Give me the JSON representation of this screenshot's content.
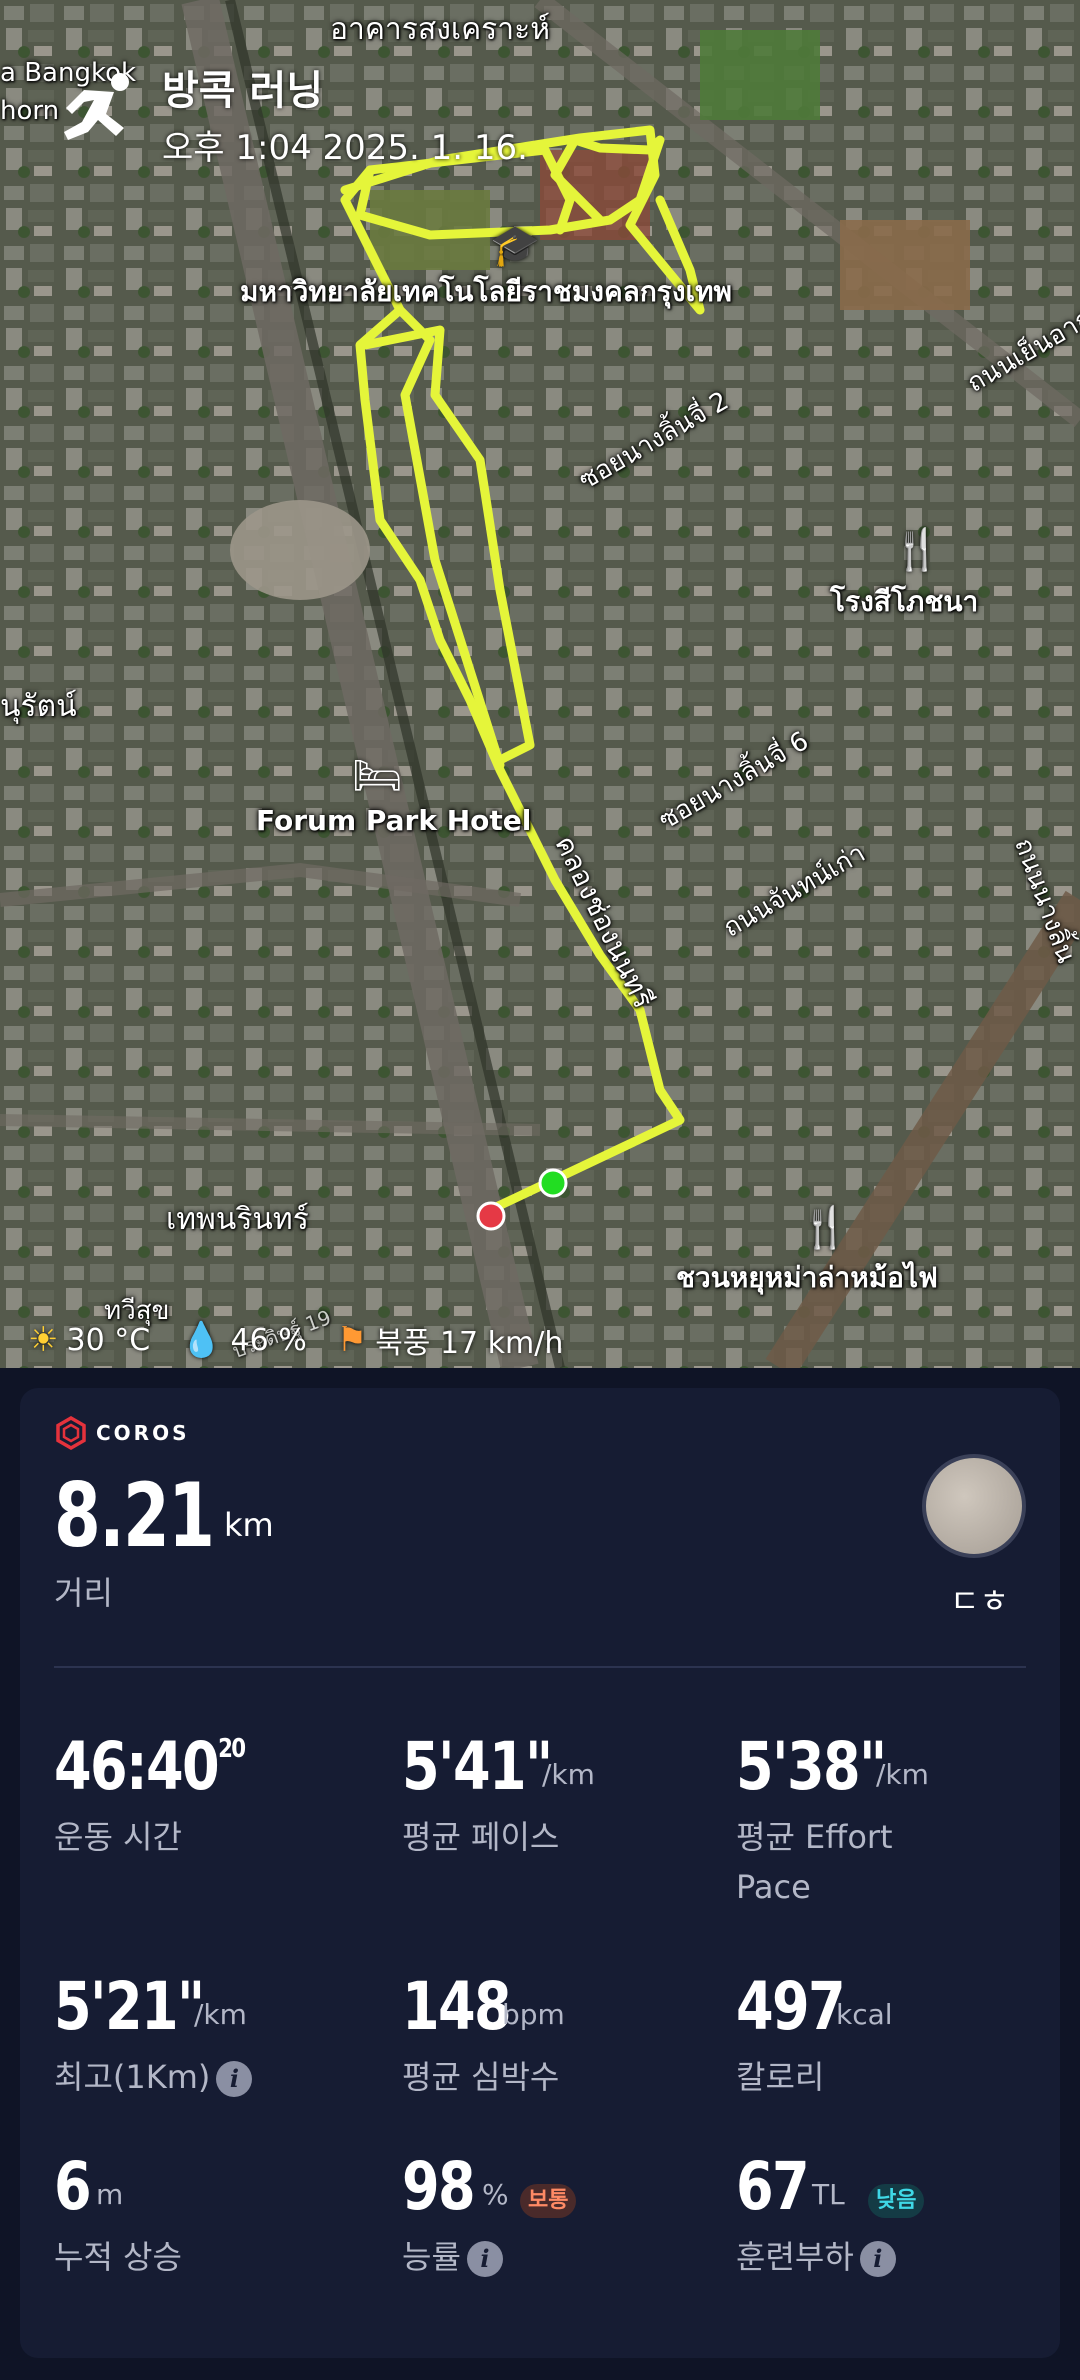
{
  "header": {
    "title": "방콕 러닝",
    "date": "오후 1:04 2025. 1. 16."
  },
  "map": {
    "labels": {
      "top_building": "อาคารสงเคราะห์",
      "corner_left_1": "a Bangkok",
      "corner_left_2": "horn",
      "university": "มหาวิทยาลัยเทคโนโลยีราชมงคลกรุงเทพ",
      "soi_2": "ซอยนางลิ้นจี่ 2",
      "road_right_top": "ถนนเย็นอาก",
      "restaurant_1": "โรงสีโภชนา",
      "left_mid": "นุรัตน์",
      "soi_6": "ซอยนางลิ้นจี่ 6",
      "hotel": "Forum Park Hotel",
      "canal": "คลองช่องนนทรี",
      "road_mid": "ถนนจันทน์เก่า",
      "road_right_mid": "ถนนนางลิ้น",
      "bottom_left": "เทพนรินทร์",
      "restaurant_2": "ชวนหยุหม่าล่าหม้อไฟ",
      "bottom_tiny": "ทวีสุข",
      "bottom_tiny_2": "ประดิษฐ์ 19"
    }
  },
  "weather": {
    "temp": "30 °C",
    "humidity": "46 %",
    "wind": "북풍 17 km/h"
  },
  "card": {
    "brand": "COROS",
    "distance": {
      "value": "8.21",
      "unit": "km",
      "label": "거리"
    },
    "user_name": "ㄷㅎ",
    "stats": {
      "duration": {
        "value": "46:40",
        "sup": "20",
        "label": "운동 시간"
      },
      "avg_pace": {
        "value": "5'41\"",
        "unit": "/km",
        "label": "평균 페이스"
      },
      "effort_pace": {
        "value": "5'38\"",
        "unit": "/km",
        "label": "평균 Effort Pace"
      },
      "best_km": {
        "value": "5'21\"",
        "unit": "/km",
        "label": "최고(1Km)"
      },
      "heart_rate": {
        "value": "148",
        "unit": "bpm",
        "label": "평균 심박수"
      },
      "calories": {
        "value": "497",
        "unit": "kcal",
        "label": "칼로리"
      },
      "elevation": {
        "value": "6",
        "unit": "m",
        "label": "누적 상승"
      },
      "efficiency": {
        "value": "98",
        "unit": "%",
        "badge": "보통",
        "label": "능률"
      },
      "training_load": {
        "value": "67",
        "unit": "TL",
        "badge": "낮음",
        "label": "훈련부하"
      }
    }
  },
  "colors": {
    "route": "#e5f53a",
    "start": "#22dd22",
    "end": "#e53945",
    "card_bg": "#161c33",
    "page_bg": "#0f1426"
  }
}
